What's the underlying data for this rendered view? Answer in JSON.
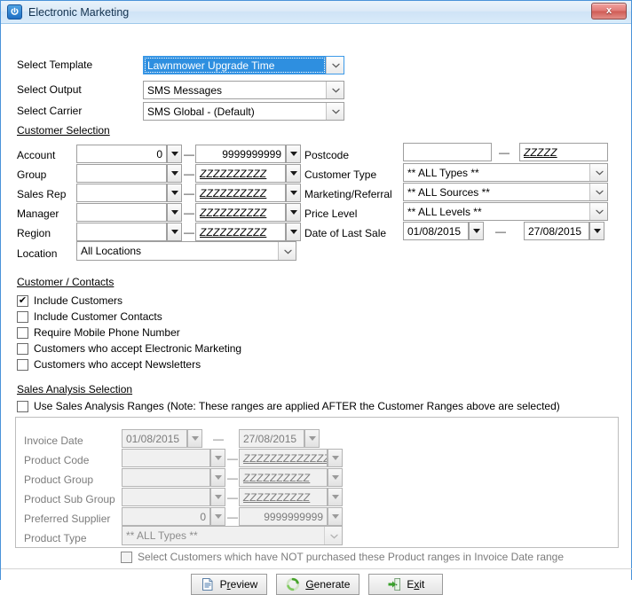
{
  "window": {
    "title": "Electronic Marketing",
    "app_icon": "power-icon",
    "close_label": "x"
  },
  "top_form": {
    "rows": [
      {
        "label": "Select Template",
        "value": "Lawnmower Upgrade Time",
        "focused": true
      },
      {
        "label": "Select Output",
        "value": "SMS Messages",
        "focused": false
      },
      {
        "label": "Select Carrier",
        "value": "SMS Global - (Default)",
        "focused": false
      }
    ]
  },
  "customer_selection": {
    "title": "Customer Selection",
    "left_rows": [
      {
        "label": "Account",
        "from": "0",
        "to": "9999999999",
        "dash": "—",
        "numeric": true
      },
      {
        "label": "Group",
        "from": "",
        "to": "ZZZZZZZZZZ",
        "dash": "—",
        "numeric": false
      },
      {
        "label": "Sales Rep",
        "from": "",
        "to": "ZZZZZZZZZZ",
        "dash": "—",
        "numeric": false
      },
      {
        "label": "Manager",
        "from": "",
        "to": "ZZZZZZZZZZ",
        "dash": "—",
        "numeric": false
      },
      {
        "label": "Region",
        "from": "",
        "to": "ZZZZZZZZZZ",
        "dash": "—",
        "numeric": false
      }
    ],
    "location": {
      "label": "Location",
      "value": "All Locations"
    },
    "postcode": {
      "label": "Postcode",
      "from": "",
      "to": "ZZZZZ",
      "dash": "—"
    },
    "customer_type": {
      "label": "Customer Type",
      "value": "** ALL Types **"
    },
    "marketing_referral": {
      "label": "Marketing/Referral",
      "value": "** ALL Sources **"
    },
    "price_level": {
      "label": "Price Level",
      "value": "** ALL Levels **"
    },
    "date_of_last_sale": {
      "label": "Date of Last Sale",
      "from": "01/08/2015",
      "to": "27/08/2015",
      "dash": "—"
    }
  },
  "customer_contacts": {
    "title": "Customer / Contacts",
    "items": [
      {
        "label": "Include Customers",
        "checked": true
      },
      {
        "label": "Include Customer Contacts",
        "checked": false
      },
      {
        "label": "Require Mobile Phone Number",
        "checked": false
      },
      {
        "label": "Customers who accept Electronic Marketing",
        "checked": false
      },
      {
        "label": "Customers who accept Newsletters",
        "checked": false
      }
    ]
  },
  "sales_analysis": {
    "title": "Sales Analysis Selection",
    "use_ranges": {
      "label": "Use Sales Analysis Ranges (Note: These ranges are applied AFTER the Customer Ranges above are selected)",
      "checked": false
    },
    "invoice_date": {
      "label": "Invoice Date",
      "from": "01/08/2015",
      "to": "27/08/2015",
      "dash": "—"
    },
    "rows": [
      {
        "label": "Product Code",
        "from": "",
        "to": "ZZZZZZZZZZZZZ",
        "dash": "—",
        "numeric": false
      },
      {
        "label": "Product Group",
        "from": "",
        "to": "ZZZZZZZZZZ",
        "dash": "—",
        "numeric": false
      },
      {
        "label": "Product Sub Group",
        "from": "",
        "to": "ZZZZZZZZZZ",
        "dash": "—",
        "numeric": false
      },
      {
        "label": "Preferred Supplier",
        "from": "0",
        "to": "9999999999",
        "dash": "—",
        "numeric": true
      }
    ],
    "product_type": {
      "label": "Product Type",
      "value": "** ALL Types **"
    },
    "not_purchased": {
      "label": "Select Customers which have NOT purchased these Product ranges in Invoice Date range",
      "checked": false
    }
  },
  "buttons": [
    {
      "name": "preview",
      "pre": "P",
      "accel": "r",
      "post": "eview",
      "icon": "document-icon"
    },
    {
      "name": "generate",
      "pre": "",
      "accel": "G",
      "post": "enerate",
      "icon": "refresh-icon"
    },
    {
      "name": "exit",
      "pre": "E",
      "accel": "x",
      "post": "it",
      "icon": "exit-door-icon"
    }
  ],
  "colors": {
    "accent": "#2e8fe0",
    "title_border": "#4a93d9",
    "close_red": "#cf5b55"
  }
}
